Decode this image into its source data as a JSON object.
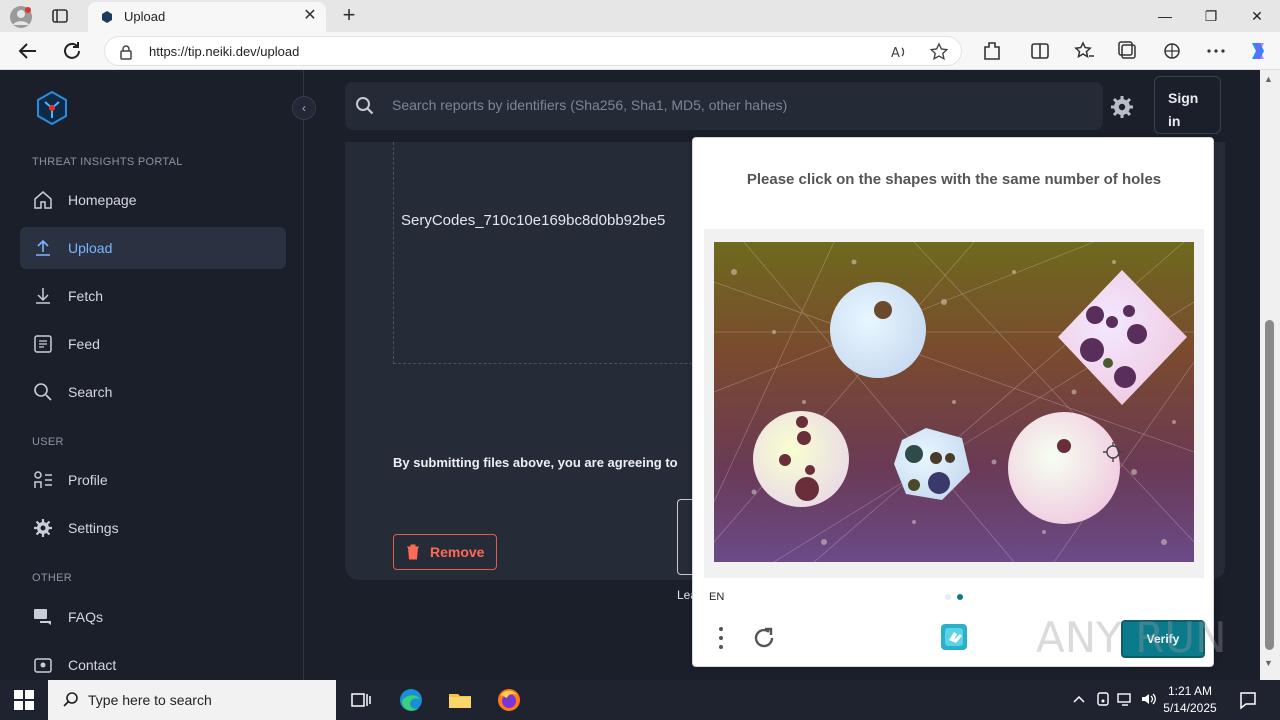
{
  "browser": {
    "tab_title": "Upload",
    "url": "https://tip.neiki.dev/upload"
  },
  "sidebar": {
    "sections": {
      "portal": "THREAT INSIGHTS PORTAL",
      "user": "USER",
      "other": "OTHER"
    },
    "items": [
      {
        "label": "Homepage",
        "icon": "home-icon"
      },
      {
        "label": "Upload",
        "icon": "upload-icon",
        "active": true
      },
      {
        "label": "Fetch",
        "icon": "download-icon"
      },
      {
        "label": "Feed",
        "icon": "feed-icon"
      },
      {
        "label": "Search",
        "icon": "search-icon"
      },
      {
        "label": "Profile",
        "icon": "profile-icon"
      },
      {
        "label": "Settings",
        "icon": "gear-icon"
      },
      {
        "label": "FAQs",
        "icon": "faq-icon"
      },
      {
        "label": "Contact",
        "icon": "contact-icon"
      }
    ]
  },
  "header": {
    "search_placeholder": "Search reports by identifiers (Sha256, Sha1, MD5, other hahes)",
    "signin_line1": "Sign",
    "signin_line2": "in"
  },
  "upload": {
    "file_name": "SeryCodes_710c10e169bc8d0bb92be5",
    "agreement": "By submitting files above, you are agreeing to",
    "remove_label": "Remove",
    "learn_label": "Learn how"
  },
  "captcha": {
    "prompt": "Please click on the shapes with the same number of holes",
    "language": "EN",
    "verify_label": "Verify",
    "page_current": 2,
    "page_total": 2
  },
  "watermark": "ANY RUN",
  "taskbar": {
    "search_placeholder": "Type here to search",
    "time": "1:21 AM",
    "date": "5/14/2025"
  },
  "colors": {
    "accent": "#7cb6ff",
    "danger": "#ff6a55",
    "captcha_teal": "#0b7b8b"
  }
}
